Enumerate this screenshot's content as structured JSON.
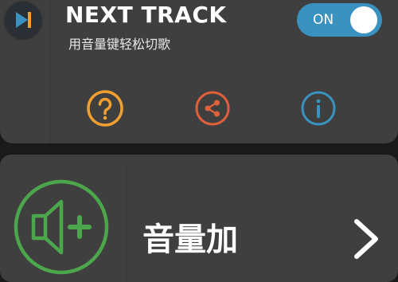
{
  "app": {
    "title": "NEXT TRACK",
    "subtitle": "用音量键轻松切歌",
    "icon": "play-next-icon"
  },
  "toggle": {
    "label": "ON",
    "state": "on",
    "color": "#3a92c0"
  },
  "actions": [
    {
      "icon": "help-icon",
      "color": "#f0a030"
    },
    {
      "icon": "share-icon",
      "color": "#e0603c"
    },
    {
      "icon": "info-icon",
      "color": "#3a92c0"
    }
  ],
  "volume_item": {
    "label": "音量加",
    "icon": "volume-up-icon",
    "icon_color": "#4ca74c",
    "chevron": "chevron-right-icon"
  }
}
